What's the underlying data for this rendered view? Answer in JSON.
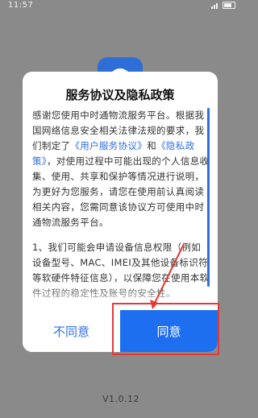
{
  "status_bar": {
    "time": "11:57"
  },
  "app": {
    "logo": "app-logo-icon",
    "version": "V1.0.12"
  },
  "dialog": {
    "title": "服务协议及隐私政策",
    "p1_intro": "感谢您使用中时通物流服务平台。根据我国网络信息安全相关法律法规的要求，我们制定了",
    "link_user_agreement": "《用户服务协议》",
    "and": "和",
    "link_privacy": "《隐私政策》",
    "p1_rest": "，对使用过程中可能出现的个人信息收集、使用、共享和保护等情况进行说明，为更好为您服务，请您在使用前认真阅读相关内容，您需同意该协议方可使用中时通物流服务平台。",
    "p2": "1、我们可能会申请设备信息权限（例如设备型号、MAC、IMEI及其他设备标识符等软硬件特征信息），以保障您在使用本软件过程的稳定性及账号的安全性。",
    "disagree_label": "不同意",
    "agree_label": "同意"
  },
  "colors": {
    "accent": "#1d6ff0",
    "link": "#2e6fe0",
    "annotation": "#e53935",
    "overlay": "#8a8a8a"
  }
}
